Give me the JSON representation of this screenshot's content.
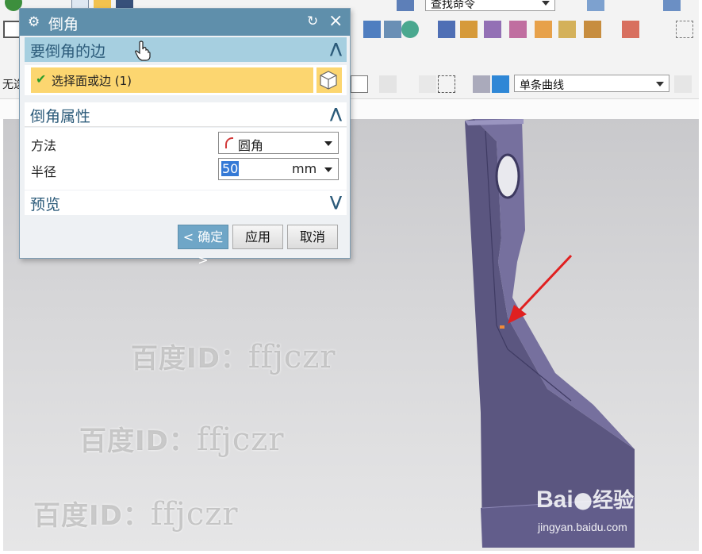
{
  "toolbar": {
    "row1": {
      "command_finder_placeholder": "查找命令"
    },
    "row3": {
      "left_label": "无选",
      "curve_rule": "单条曲线"
    }
  },
  "dialog": {
    "title": "倒角",
    "gear_icon": "gear-icon",
    "reset_icon": "reset-icon",
    "close_icon": "close-icon",
    "sections": {
      "edges": {
        "title": "要倒角的边",
        "select_label": "选择面或边 (1)",
        "collapse_icon": "chevron-up-icon"
      },
      "properties": {
        "title": "倒角属性",
        "method_label": "方法",
        "method_value": "圆角",
        "radius_label": "半径",
        "radius_value": "50",
        "radius_unit": "mm",
        "collapse_icon": "chevron-up-icon"
      },
      "preview": {
        "title": "预览",
        "expand_icon": "chevron-down-icon"
      }
    },
    "buttons": {
      "ok": "< 确定 >",
      "apply": "应用",
      "cancel": "取消"
    }
  },
  "watermarks": [
    {
      "prefix": "百度ID：",
      "id": "ffjczr"
    },
    {
      "prefix": "百度ID：",
      "id": "ffjczr"
    },
    {
      "prefix": "百度ID：",
      "id": "ffjczr"
    }
  ],
  "baidu": {
    "logo_text": "Bai",
    "logo_suffix": "经验",
    "site": "jingyan.baidu.com"
  },
  "colors": {
    "dialog_title_bg": "#5f8fab",
    "section_active_bg": "#a6cfe0",
    "selection_field_bg": "#fcd670",
    "ok_button_bg": "#6fa6c7",
    "part_color": "#6b6592",
    "annotation_arrow": "#e02020"
  }
}
